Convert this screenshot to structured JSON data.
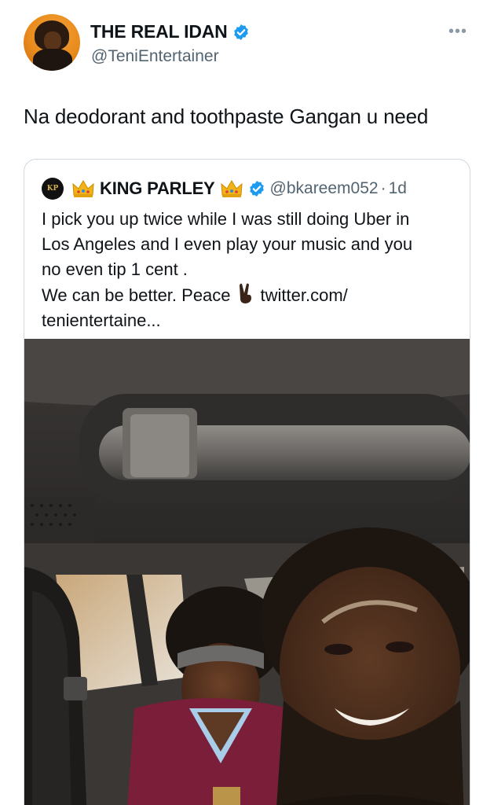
{
  "author": {
    "display_name": "THE REAL IDAN",
    "handle": "@TeniEntertainer",
    "verified": true,
    "avatar_icon": "profile-photo"
  },
  "tweet": {
    "text": "Na deodorant and toothpaste Gangan u need"
  },
  "more_icon": "more-horizontal-icon",
  "quoted_tweet": {
    "avatar_text": "KP",
    "display_name": "KING PARLEY",
    "handle": "@bkareem052",
    "separator": "·",
    "time": "1d",
    "verified": true,
    "text_lines": [
      "I pick you up twice while I was still doing Uber in",
      "Los Angeles and I even play your music and you",
      "no even tip 1 cent .",
      "We can be better. Peace",
      "twitter.com/",
      "tenientertaine..."
    ],
    "media_alt": "selfie-photo-in-car"
  },
  "colors": {
    "text": "#0f1419",
    "secondary": "#536471",
    "verified_blue": "#1d9bf0",
    "border": "#cfd9de"
  }
}
